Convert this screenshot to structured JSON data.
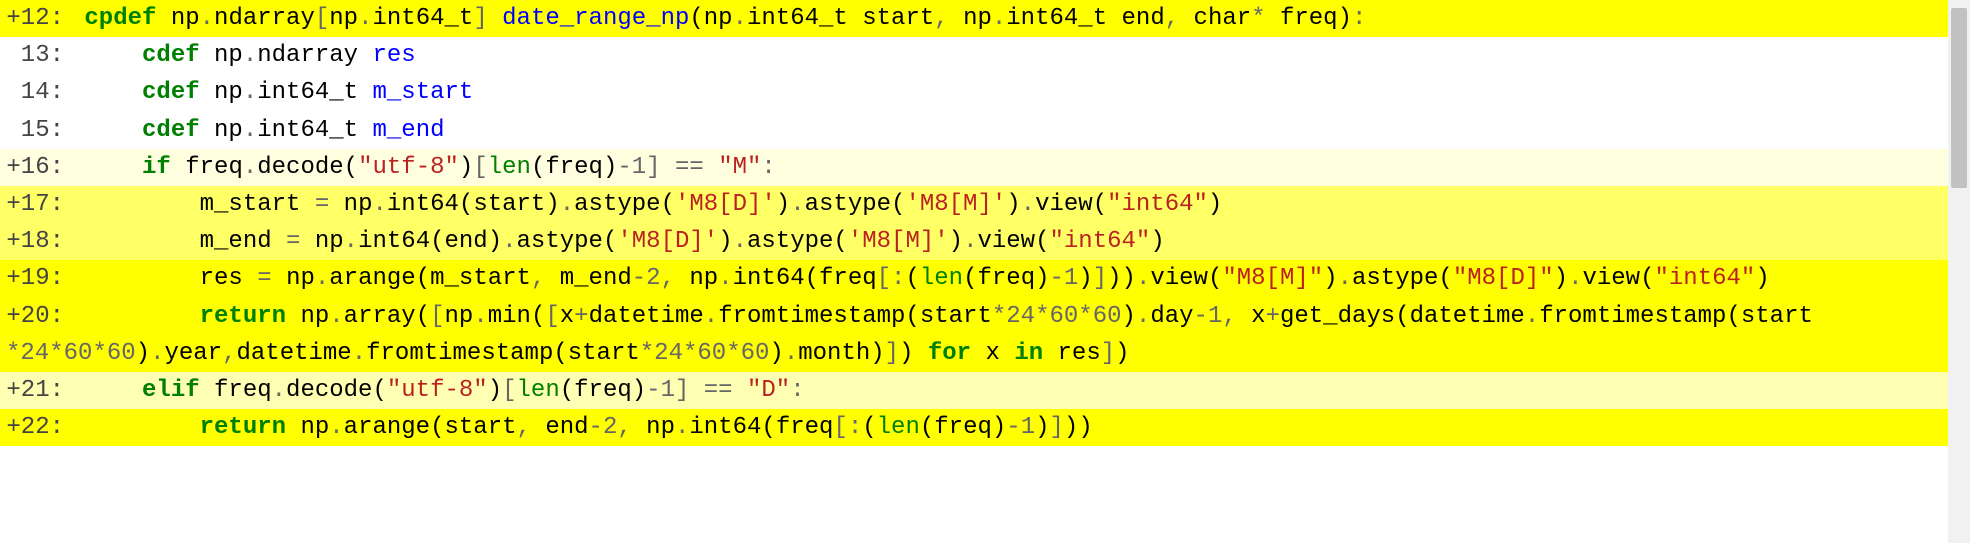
{
  "lines": [
    {
      "gutter": "+12:",
      "hl": "hl-4"
    },
    {
      "gutter": " 13:",
      "hl": "hl-0"
    },
    {
      "gutter": " 14:",
      "hl": "hl-0"
    },
    {
      "gutter": " 15:",
      "hl": "hl-0"
    },
    {
      "gutter": "+16:",
      "hl": "hl-1"
    },
    {
      "gutter": "+17:",
      "hl": "hl-3"
    },
    {
      "gutter": "+18:",
      "hl": "hl-3"
    },
    {
      "gutter": "+19:",
      "hl": "hl-4"
    },
    {
      "gutter": "+20:",
      "hl": "hl-4"
    },
    {
      "gutter": "",
      "hl": "hl-4"
    },
    {
      "gutter": "+21:",
      "hl": "hl-2"
    },
    {
      "gutter": "+22:",
      "hl": "hl-4"
    }
  ],
  "kw": {
    "cpdef": "cpdef",
    "cdef": "cdef",
    "return": "return",
    "for": "for",
    "in": "in",
    "if": "if",
    "elif": "elif"
  },
  "ident": {
    "np": "np",
    "ndarray": "ndarray",
    "int64_t": "int64_t",
    "int64": "int64",
    "arange": "arange",
    "astype": "astype",
    "view": "view",
    "decode": "decode",
    "array": "array",
    "min": "min",
    "datetime": "datetime",
    "fromtimestamp": "fromtimestamp",
    "day": "day",
    "year": "year",
    "month": "month",
    "get_days": "get_days",
    "freq": "freq",
    "start": "start",
    "end": "end",
    "char": "char",
    "res": "res",
    "m_start": "m_start",
    "m_end": "m_end",
    "x": "x",
    "len": "len"
  },
  "fn": {
    "date_range_np": "date_range_np"
  },
  "str": {
    "utf8": "\"utf-8\"",
    "M": "\"M\"",
    "D": "\"D\"",
    "M8D_s": "'M8[D]'",
    "M8M_s": "'M8[M]'",
    "int64_d": "\"int64\"",
    "M8M_d": "\"M8[M]\"",
    "M8D_d": "\"M8[D]\""
  },
  "num": {
    "n1": "1",
    "n2": "2",
    "n24": "24",
    "n60": "60"
  },
  "op": {
    "dot": ".",
    "lbr": "[",
    "rbr": "]",
    "lp": "(",
    "rp": ")",
    "colon": ":",
    "comma": ",",
    "eqeq": "==",
    "eq": "=",
    "minus": "-",
    "plus": "+",
    "star": "*",
    "space": " "
  },
  "indent": {
    "i0": " ",
    "i1": "     ",
    "i2": "         ",
    "cont": ""
  }
}
